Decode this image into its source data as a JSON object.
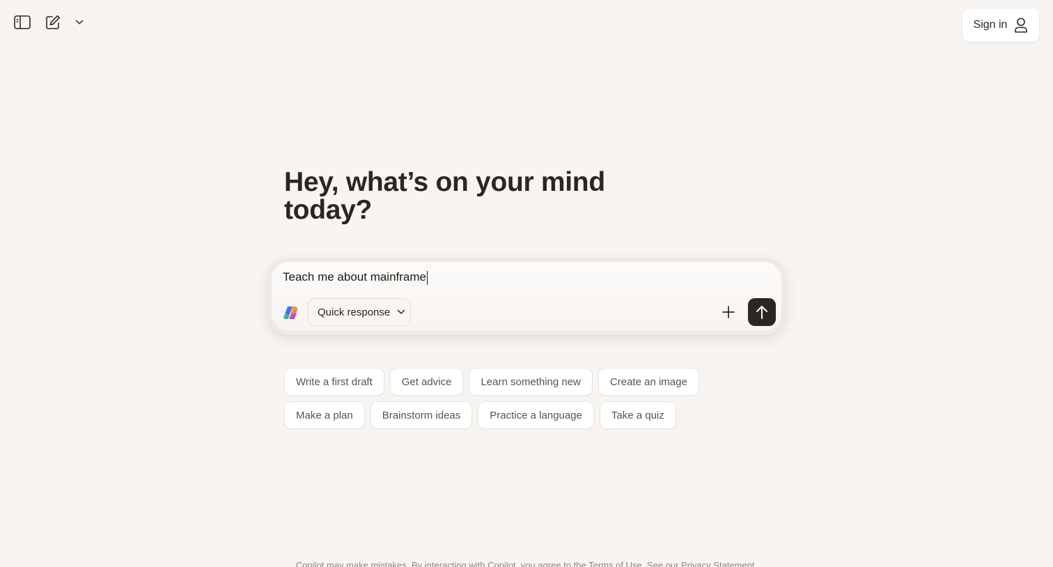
{
  "topbar": {
    "sidebar_icon": "sidebar-toggle-icon",
    "new_chat_icon": "compose-icon",
    "dropdown_icon": "chevron-down-icon"
  },
  "signin": {
    "label": "Sign in",
    "icon": "person-icon"
  },
  "headline": "Hey, what’s on your mind today?",
  "composer": {
    "value": "Teach me about mainframe",
    "mode_label": "Quick response",
    "mode_icon": "chevron-down-icon",
    "logo": "copilot-logo-icon",
    "add_icon": "plus-icon",
    "send_icon": "arrow-up-icon"
  },
  "suggestions": {
    "row1": [
      "Write a first draft",
      "Get advice",
      "Learn something new",
      "Create an image"
    ],
    "row2": [
      "Make a plan",
      "Brainstorm ideas",
      "Practice a language",
      "Take a quiz"
    ]
  },
  "disclaimer": {
    "prefix": "Copilot may make mistakes. By interacting with Copilot, you agree to the ",
    "terms": "Terms of Use",
    "middle": ". See our ",
    "privacy": "Privacy Statement",
    "suffix": "."
  },
  "colors": {
    "background": "#f7f4f1",
    "text": "#2a2623",
    "send_button": "#2a2623",
    "chip_text": "#5b534d"
  }
}
